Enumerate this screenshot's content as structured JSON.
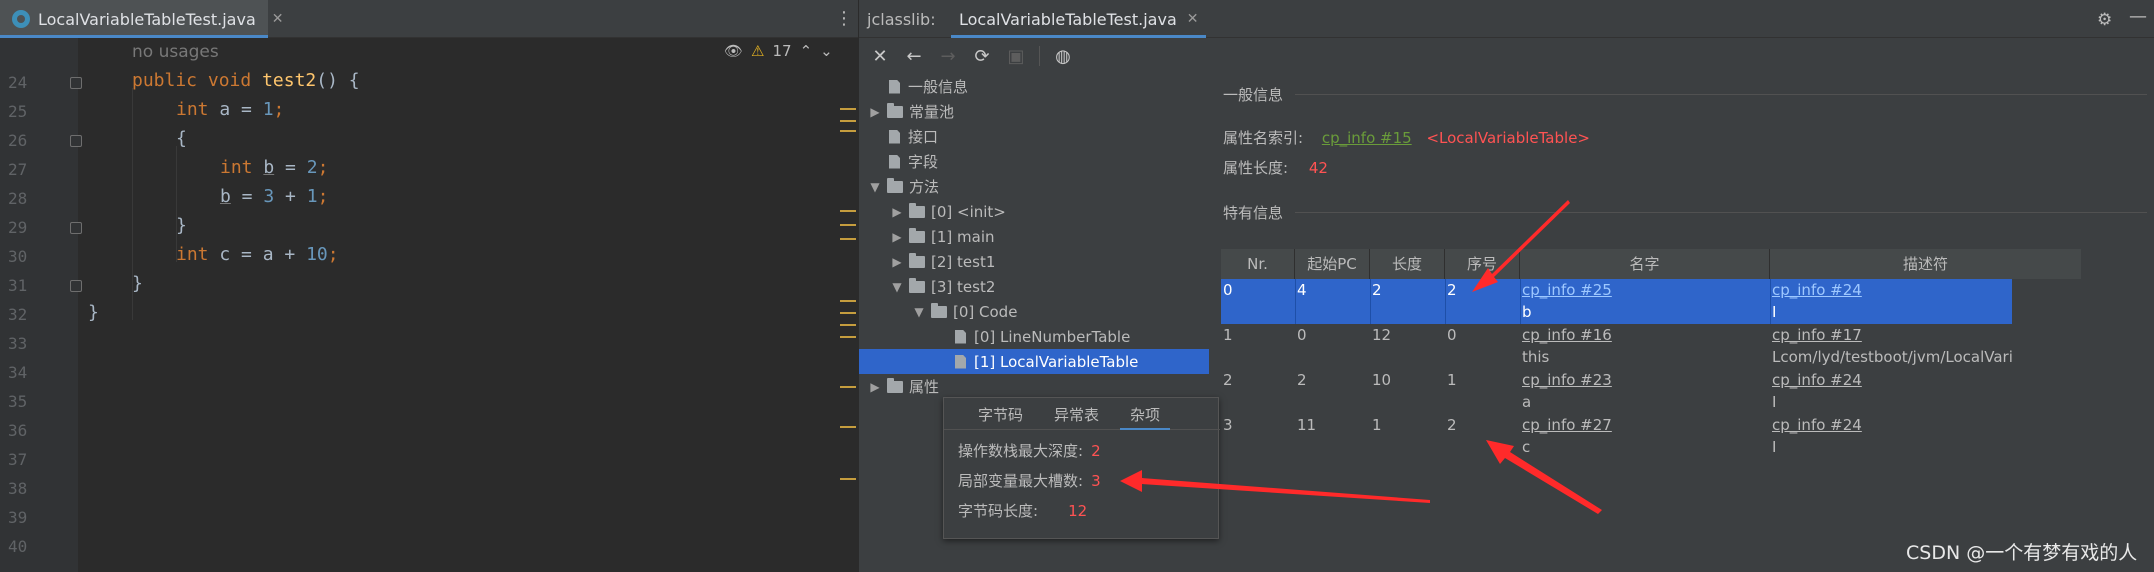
{
  "editor": {
    "tab_label": "LocalVariableTableTest.java",
    "warning_count": "17",
    "hint_text": "no usages",
    "line_numbers": [
      "24",
      "25",
      "26",
      "27",
      "28",
      "29",
      "30",
      "31",
      "32",
      "33",
      "34",
      "35",
      "36",
      "37",
      "38",
      "39",
      "40"
    ],
    "code": {
      "l24_kw": "public",
      "l24_kw2": "void",
      "l24_fn": "test2",
      "l24_rest": "() {",
      "l25_kw": "int",
      "l25_var": " a = ",
      "l25_num": "1",
      "l25_end": ";",
      "l26": "{",
      "l27_kw": "int",
      "l27_var": "b",
      "l27_eq": " = ",
      "l27_num": "2",
      "l27_end": ";",
      "l28_var": "b",
      "l28_eq": " = ",
      "l28_num1": "3",
      "l28_plus": " + ",
      "l28_num2": "1",
      "l28_end": ";",
      "l29": "}",
      "l30_kw": "int",
      "l30_var": " c = a + ",
      "l30_num": "10",
      "l30_end": ";",
      "l31": "}",
      "l32": "}"
    }
  },
  "jclasslib": {
    "title": "jclasslib:",
    "tab_label": "LocalVariableTableTest.java",
    "tree": {
      "general": "一般信息",
      "constant_pool": "常量池",
      "interfaces": "接口",
      "fields": "字段",
      "methods": "方法",
      "m0": "[0] <init>",
      "m1": "[1] main",
      "m2": "[2] test1",
      "m3": "[3] test2",
      "code": "[0] Code",
      "lnt": "[0] LineNumberTable",
      "lvt": "[1] LocalVariableTable",
      "attributes": "属性"
    },
    "popup": {
      "tabs": [
        "字节码",
        "异常表",
        "杂项"
      ],
      "max_stack_label": "操作数栈最大深度:",
      "max_stack_value": "2",
      "max_locals_label": "局部变量最大槽数:",
      "max_locals_value": "3",
      "code_length_label": "字节码长度:",
      "code_length_value": "12"
    },
    "detail": {
      "general_section": "一般信息",
      "name_index_label": "属性名索引:",
      "name_index_link": "cp_info #15",
      "name_index_value": "<LocalVariableTable>",
      "length_label": "属性长度:",
      "length_value": "42",
      "specific_section": "特有信息"
    },
    "table": {
      "headers": [
        "Nr.",
        "起始PC",
        "长度",
        "序号",
        "名字",
        "描述符"
      ],
      "rows": [
        {
          "nr": "0",
          "start": "4",
          "len": "2",
          "idx": "2",
          "name_link": "cp_info #25",
          "name": "b",
          "desc_link": "cp_info #24",
          "desc": "I"
        },
        {
          "nr": "1",
          "start": "0",
          "len": "12",
          "idx": "0",
          "name_link": "cp_info #16",
          "name": "this",
          "desc_link": "cp_info #17",
          "desc": "Lcom/lyd/testboot/jvm/LocalVaria"
        },
        {
          "nr": "2",
          "start": "2",
          "len": "10",
          "idx": "1",
          "name_link": "cp_info #23",
          "name": "a",
          "desc_link": "cp_info #24",
          "desc": "I"
        },
        {
          "nr": "3",
          "start": "11",
          "len": "1",
          "idx": "2",
          "name_link": "cp_info #27",
          "name": "c",
          "desc_link": "cp_info #24",
          "desc": "I"
        }
      ]
    }
  },
  "watermark": "CSDN @一个有梦有戏的人",
  "colors": {
    "accent": "#4a88c7",
    "selection": "#2f65ca",
    "keyword": "#cc7832",
    "number": "#6897bb",
    "value_red": "#ff5353",
    "annotation_arrow": "#ff2a2a"
  }
}
